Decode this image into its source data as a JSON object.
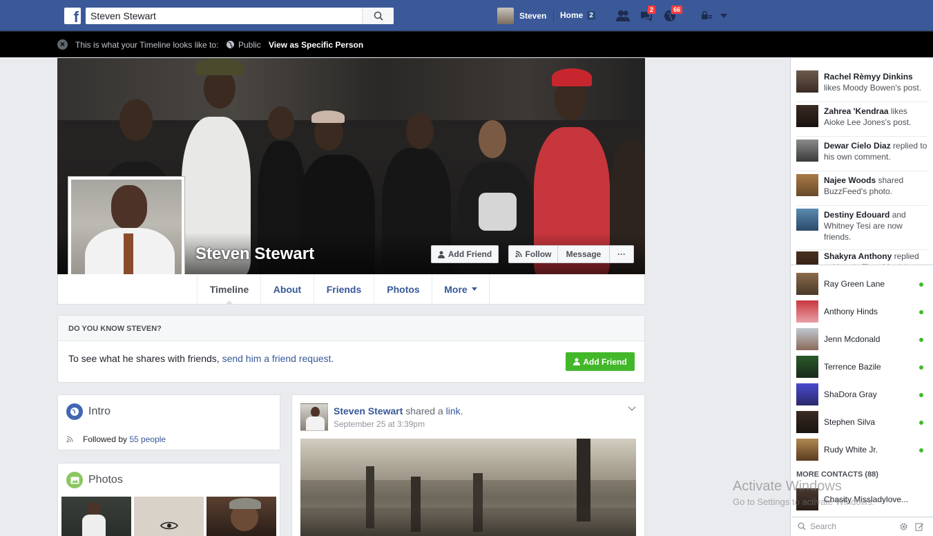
{
  "topbar": {
    "logo": "f",
    "search_value": "Steven Stewart",
    "user_name": "Steven",
    "home_label": "Home",
    "home_count": "2",
    "messages_count": "2",
    "notifications_count": "66"
  },
  "viewbar": {
    "text": "This is what your Timeline looks like to:",
    "audience": "Public",
    "view_specific": "View as Specific Person"
  },
  "profile": {
    "name": "Steven Stewart",
    "buttons": {
      "add_friend": "Add Friend",
      "follow": "Follow",
      "message": "Message",
      "more": "···"
    }
  },
  "tabs": [
    "Timeline",
    "About",
    "Friends",
    "Photos",
    "More"
  ],
  "do_you_know": {
    "title": "DO YOU KNOW STEVEN?",
    "text": "To see what he shares with friends,",
    "link": "send him a friend request.",
    "button": "Add Friend"
  },
  "intro": {
    "title": "Intro",
    "followed_by": "Followed by",
    "followers_link": "55 people"
  },
  "photos": {
    "title": "Photos"
  },
  "post": {
    "author": "Steven Stewart",
    "action": "shared a",
    "link": "link.",
    "date": "September 25 at 3:39pm"
  },
  "ticker": [
    {
      "name": "Rachel Rèmyy Dinkins",
      "text": "likes Moody Bowen's post."
    },
    {
      "name": "Zahrea 'Kendraa",
      "text": "likes Aioke Lee Jones's post."
    },
    {
      "name": "Dewar Cielo Diaz",
      "text": "replied to his own comment."
    },
    {
      "name": "Najee Woods",
      "text": "shared BuzzFeed's photo."
    },
    {
      "name": "Destiny Edouard",
      "text": "and Whitney Tesi are now friends."
    },
    {
      "name": "Shakyra Anthony",
      "text": "replied to Yasmin Timo Mattick"
    }
  ],
  "chat": [
    {
      "name": "Ray Green Lane"
    },
    {
      "name": "Anthony Hinds"
    },
    {
      "name": "Jenn Mcdonald"
    },
    {
      "name": "Terrence Bazile"
    },
    {
      "name": "ShaDora Gray"
    },
    {
      "name": "Stephen Silva"
    },
    {
      "name": "Rudy White Jr."
    }
  ],
  "more_contacts": "MORE CONTACTS (88)",
  "more_contacts_first": "Chasity Missladylove...",
  "chat_search_placeholder": "Search",
  "watermark": {
    "line1": "Activate Windows",
    "line2": "Go to Settings to activate Windows."
  },
  "colors": {
    "brand": "#3b5998",
    "link": "#365899",
    "green": "#42b72a",
    "badge": "#fa3e3e"
  }
}
